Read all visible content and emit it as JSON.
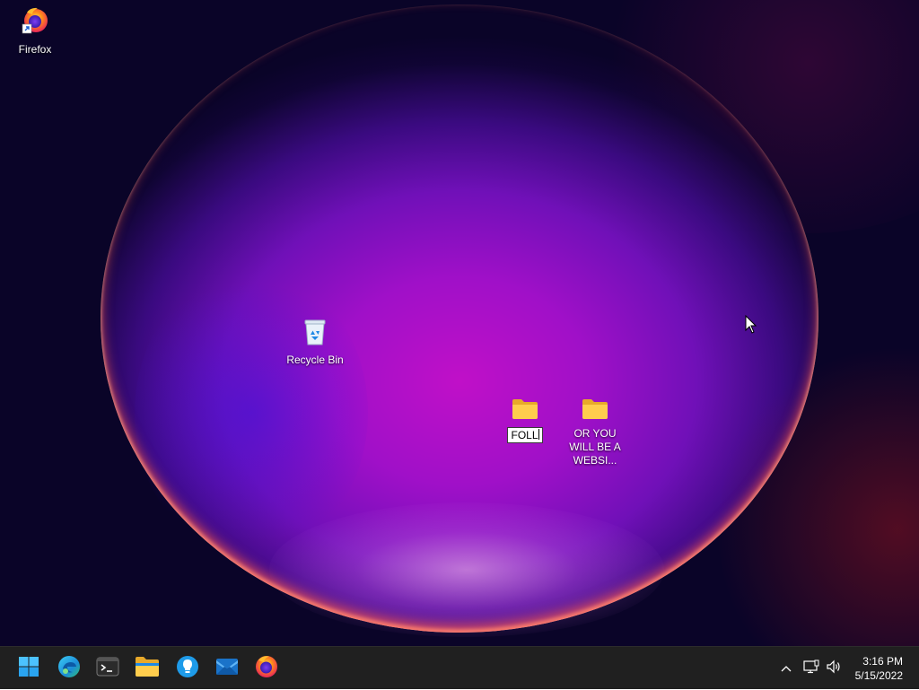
{
  "desktop": {
    "icons": [
      {
        "label": "Firefox",
        "icon": "firefox-shortcut-icon"
      },
      {
        "label": "Recycle Bin",
        "icon": "recycle-bin-icon"
      },
      {
        "rename_value": "FOLL",
        "icon": "folder-icon"
      },
      {
        "label": "OR YOU WILL BE A WEBSI...",
        "icon": "folder-icon"
      }
    ],
    "colors": {
      "background": "#0a0428",
      "orb_core": "#c010c8",
      "rim": "#ff5a50"
    }
  },
  "taskbar": {
    "apps": [
      {
        "icon": "windows-start-icon"
      },
      {
        "icon": "edge-icon"
      },
      {
        "icon": "terminal-icon"
      },
      {
        "icon": "file-explorer-icon"
      },
      {
        "icon": "tips-icon"
      },
      {
        "icon": "mail-icon"
      },
      {
        "icon": "firefox-icon"
      }
    ],
    "tray": {
      "icons": [
        "chevron-up-icon",
        "network-icon",
        "volume-icon"
      ]
    },
    "clock": {
      "time": "3:16 PM",
      "date": "5/15/2022"
    },
    "colors": {
      "background": "#202020",
      "accent": "#0078d4"
    }
  }
}
